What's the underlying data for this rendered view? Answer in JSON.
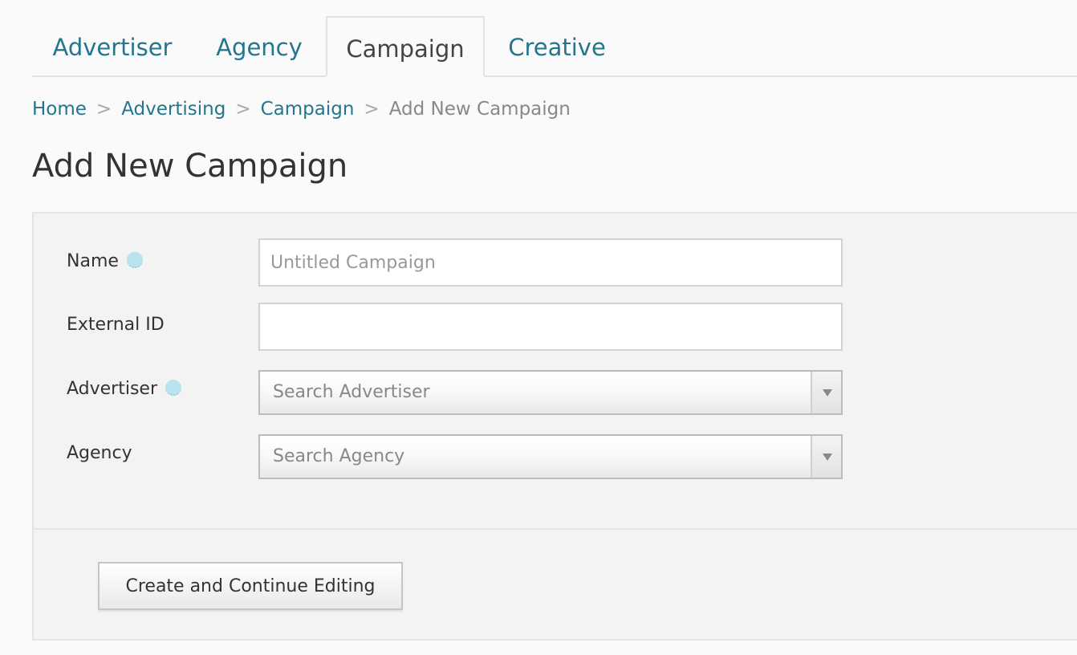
{
  "tabs": [
    {
      "label": "Advertiser",
      "active": false
    },
    {
      "label": "Agency",
      "active": false
    },
    {
      "label": "Campaign",
      "active": true
    },
    {
      "label": "Creative",
      "active": false
    }
  ],
  "breadcrumb": {
    "items": [
      "Home",
      "Advertising",
      "Campaign"
    ],
    "separator": ">",
    "current": "Add New Campaign"
  },
  "page": {
    "title": "Add New Campaign"
  },
  "form": {
    "name": {
      "label": "Name",
      "placeholder": "Untitled Campaign",
      "value": "",
      "help_icon": "info-dot-icon"
    },
    "external_id": {
      "label": "External ID",
      "placeholder": "",
      "value": ""
    },
    "advertiser": {
      "label": "Advertiser",
      "placeholder": "Search Advertiser",
      "help_icon": "info-dot-icon"
    },
    "agency": {
      "label": "Agency",
      "placeholder": "Search Agency"
    },
    "submit_label": "Create and Continue Editing"
  },
  "colors": {
    "link": "#23768e",
    "help_dot": "#b9e3ef",
    "panel_bg": "#f3f3f3"
  }
}
